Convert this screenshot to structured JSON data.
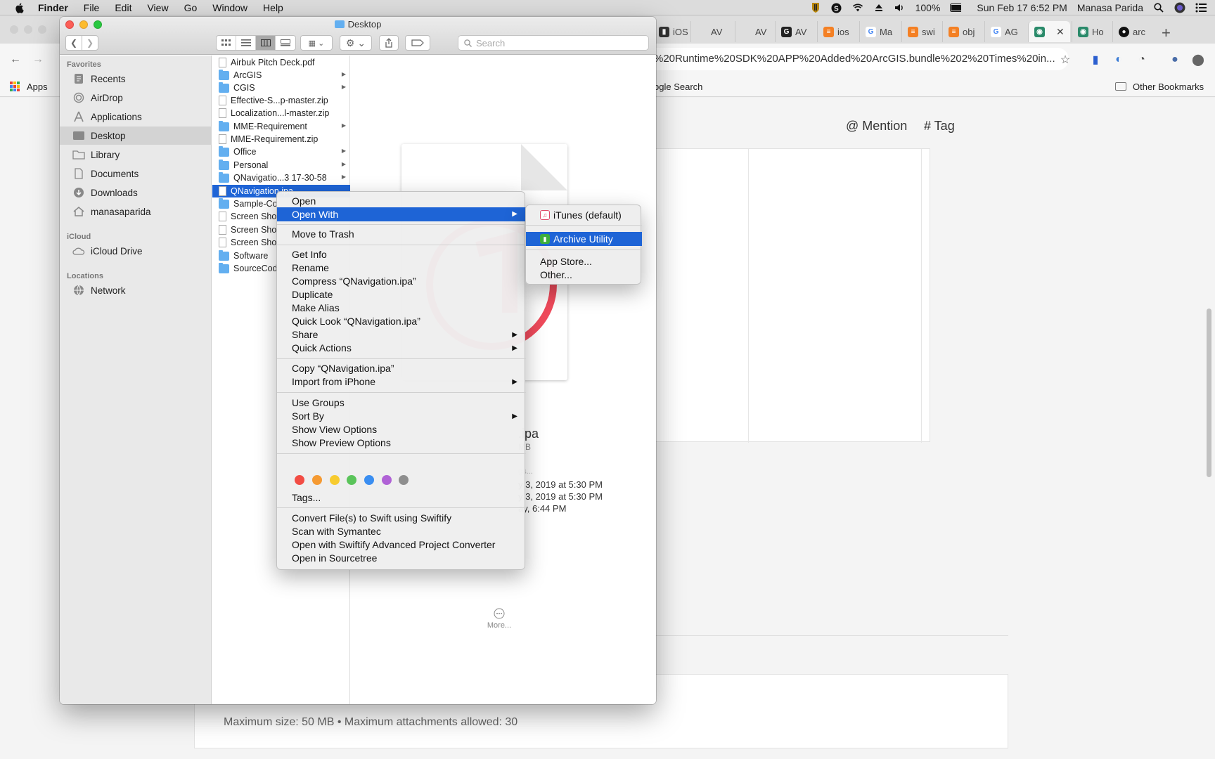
{
  "menubar": {
    "app": "Finder",
    "items": [
      "File",
      "Edit",
      "View",
      "Go",
      "Window",
      "Help"
    ],
    "battery": "100%",
    "datetime": "Sun Feb 17  6:52 PM",
    "user": "Manasa Parida"
  },
  "browser": {
    "tabs": [
      {
        "label": "iOS",
        "icon": "sheet-icon"
      },
      {
        "label": "AV",
        "icon": "apple-icon"
      },
      {
        "label": "AV",
        "icon": "apple-icon"
      },
      {
        "label": "AV",
        "icon": "g-icon"
      },
      {
        "label": "ios",
        "icon": "stack-icon"
      },
      {
        "label": "Ma",
        "icon": "google-icon"
      },
      {
        "label": "swi",
        "icon": "stack-icon"
      },
      {
        "label": "obj",
        "icon": "stack-icon"
      },
      {
        "label": "AG",
        "icon": "google-icon"
      },
      {
        "label": "",
        "icon": "globe-icon"
      },
      {
        "label": "Ho",
        "icon": "globe-icon"
      },
      {
        "label": "arc",
        "icon": "github-icon"
      }
    ],
    "url": "%20Runtime%20SDK%20APP%20Added%20ArcGIS.bundle%202%20Times%20in...",
    "bookmarks": {
      "apps": "Apps",
      "search": "ogle Search",
      "other": "Other Bookmarks"
    },
    "page": {
      "mention": "@ Mention",
      "tag": "# Tag",
      "max_info": "Maximum size: 50 MB  •  Maximum attachments allowed: 30"
    }
  },
  "finder": {
    "title": "Desktop",
    "search_placeholder": "Search",
    "sidebar": {
      "favorites_header": "Favorites",
      "favorites": [
        {
          "label": "Recents",
          "icon": "recents-icon"
        },
        {
          "label": "AirDrop",
          "icon": "airdrop-icon"
        },
        {
          "label": "Applications",
          "icon": "applications-icon"
        },
        {
          "label": "Desktop",
          "icon": "desktop-icon",
          "selected": true
        },
        {
          "label": "Library",
          "icon": "folder-icon"
        },
        {
          "label": "Documents",
          "icon": "documents-icon"
        },
        {
          "label": "Downloads",
          "icon": "downloads-icon"
        },
        {
          "label": "manasaparida",
          "icon": "home-icon"
        }
      ],
      "icloud_header": "iCloud",
      "icloud": [
        {
          "label": "iCloud Drive",
          "icon": "cloud-icon"
        }
      ],
      "locations_header": "Locations",
      "locations": [
        {
          "label": "Network",
          "icon": "network-icon"
        }
      ]
    },
    "files": [
      {
        "name": "Airbuk Pitch Deck.pdf",
        "kind": "doc",
        "folder": false
      },
      {
        "name": "ArcGIS",
        "kind": "folder",
        "folder": true
      },
      {
        "name": "CGIS",
        "kind": "folder",
        "folder": true
      },
      {
        "name": "Effective-S...p-master.zip",
        "kind": "zip",
        "folder": false
      },
      {
        "name": "Localization...l-master.zip",
        "kind": "zip",
        "folder": false
      },
      {
        "name": "MME-Requirement",
        "kind": "folder",
        "folder": true
      },
      {
        "name": "MME-Requirement.zip",
        "kind": "zip",
        "folder": false
      },
      {
        "name": "Office",
        "kind": "folder",
        "folder": true
      },
      {
        "name": "Personal",
        "kind": "folder",
        "folder": true
      },
      {
        "name": "QNavigatio...3 17-30-58",
        "kind": "folder",
        "folder": true
      },
      {
        "name": "QNavigation.ipa",
        "kind": "doc",
        "folder": false,
        "selected": true
      },
      {
        "name": "Sample-Co",
        "kind": "folder",
        "folder": true
      },
      {
        "name": "Screen Sho",
        "kind": "doc",
        "folder": false
      },
      {
        "name": "Screen Sho",
        "kind": "doc",
        "folder": false
      },
      {
        "name": "Screen Sho",
        "kind": "doc",
        "folder": false
      },
      {
        "name": "Software",
        "kind": "folder",
        "folder": true
      },
      {
        "name": "SourceCod",
        "kind": "folder",
        "folder": true
      }
    ],
    "preview": {
      "filename_part": ".ipa",
      "size_part": "MB",
      "tags_part": "gs...",
      "date1": "y 3, 2019 at 5:30 PM",
      "date2": "y 3, 2019 at 5:30 PM",
      "date3": "ay, 6:44 PM",
      "more": "More..."
    }
  },
  "context_menu": {
    "open": "Open",
    "open_with": "Open With",
    "move_to_trash": "Move to Trash",
    "get_info": "Get Info",
    "rename": "Rename",
    "compress": "Compress “QNavigation.ipa”",
    "duplicate": "Duplicate",
    "make_alias": "Make Alias",
    "quick_look": "Quick Look “QNavigation.ipa”",
    "share": "Share",
    "quick_actions": "Quick Actions",
    "copy": "Copy “QNavigation.ipa”",
    "import_iphone": "Import from iPhone",
    "use_groups": "Use Groups",
    "sort_by": "Sort By",
    "show_view_options": "Show View Options",
    "show_preview_options": "Show Preview Options",
    "tag_colors": [
      "#f24c44",
      "#f59a32",
      "#f7cb2f",
      "#5ac45a",
      "#3a8ef1",
      "#b062d6",
      "#8e8e8e"
    ],
    "tags": "Tags...",
    "swiftify_convert": "Convert File(s) to Swift using Swiftify",
    "symantec": "Scan with Symantec",
    "swiftify_advanced": "Open with Swiftify Advanced Project Converter",
    "sourcetree": "Open in Sourcetree"
  },
  "open_with_submenu": {
    "itunes": "iTunes (default)",
    "archive_utility": "Archive Utility",
    "app_store": "App Store...",
    "other": "Other..."
  },
  "colors": {
    "selection": "#1e64d6",
    "folder": "#63aff0"
  }
}
